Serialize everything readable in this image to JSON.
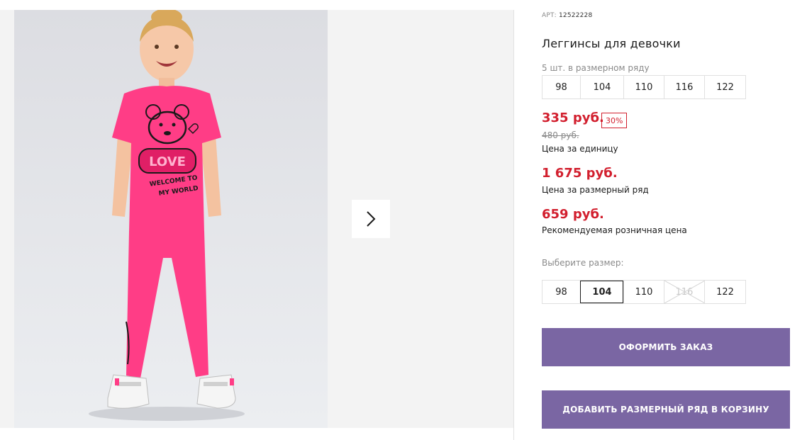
{
  "product": {
    "art_label": "АРТ:",
    "art_value": "12522228",
    "title": "Леггинсы для девочки",
    "pack_note": "5 шт. в размерном ряду",
    "pack_sizes": [
      "98",
      "104",
      "110",
      "116",
      "122"
    ],
    "discount_price": "335 руб.",
    "discount_badge": "30%",
    "old_price": "480 руб.",
    "unit_price_caption": "Цена за единицу",
    "row_price": "1 675 руб.",
    "row_price_caption": "Цена за размерный ряд",
    "retail_price": "659 руб.",
    "retail_price_caption": "Рекомендуемая розничная цена",
    "choose_size_label": "Выберите размер:",
    "size_options": [
      "98",
      "104",
      "110",
      "116",
      "122"
    ],
    "selected_size": "104",
    "unavailable_size": "116",
    "order_button": "ОФОРМИТЬ ЗАКАЗ",
    "add_row_button": "ДОБАВИТЬ РАЗМЕРНЫЙ РЯД В КОРЗИНУ"
  },
  "photo": {
    "shirt_print": [
      "LOVE",
      "WELCOME TO",
      "MY WORLD"
    ]
  },
  "colors": {
    "price_red": "#d21f2e",
    "button_purple": "#7a66a3",
    "product_pink": "#ff3d86"
  },
  "icons": {
    "next": "chevron-right-icon"
  }
}
